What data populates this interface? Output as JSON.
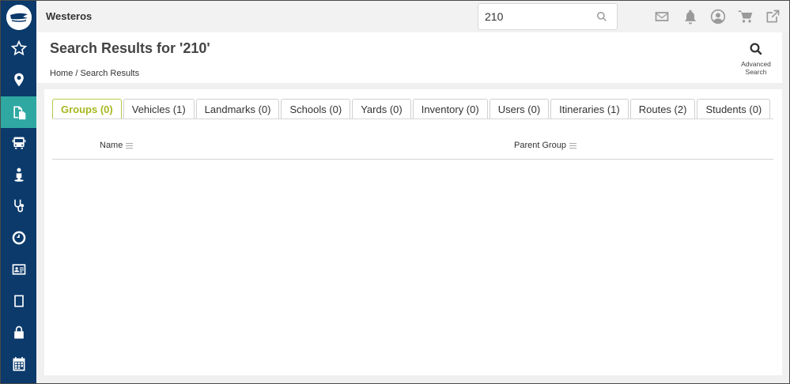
{
  "app": {
    "title": "Westeros"
  },
  "search": {
    "value": "210"
  },
  "header": {
    "page_title": "Search Results for '210'",
    "breadcrumb": "Home / Search Results",
    "advanced_search_line1": "Advanced",
    "advanced_search_line2": "Search"
  },
  "tabs": [
    {
      "label": "Groups (0)"
    },
    {
      "label": "Vehicles (1)"
    },
    {
      "label": "Landmarks (0)"
    },
    {
      "label": "Schools (0)"
    },
    {
      "label": "Yards (0)"
    },
    {
      "label": "Inventory (0)"
    },
    {
      "label": "Users (0)"
    },
    {
      "label": "Itineraries (1)"
    },
    {
      "label": "Routes (2)"
    },
    {
      "label": "Students (0)"
    }
  ],
  "grid": {
    "columns": [
      {
        "label": "Name"
      },
      {
        "label": "Parent Group"
      }
    ]
  },
  "colors": {
    "sidebar": "#0b3a6b",
    "sidebar_active": "#2fa8a2",
    "active_tab": "#a8b820"
  },
  "sidebar_icons": [
    "star-icon",
    "map-pin-icon",
    "documents-icon",
    "bus-icon",
    "person-icon",
    "stethoscope-icon",
    "clock-icon",
    "id-card-icon",
    "tablet-icon",
    "lock-icon",
    "calendar-icon"
  ],
  "top_icons": [
    "mail-icon",
    "bell-icon",
    "user-circle-icon",
    "cart-icon",
    "external-link-icon"
  ]
}
